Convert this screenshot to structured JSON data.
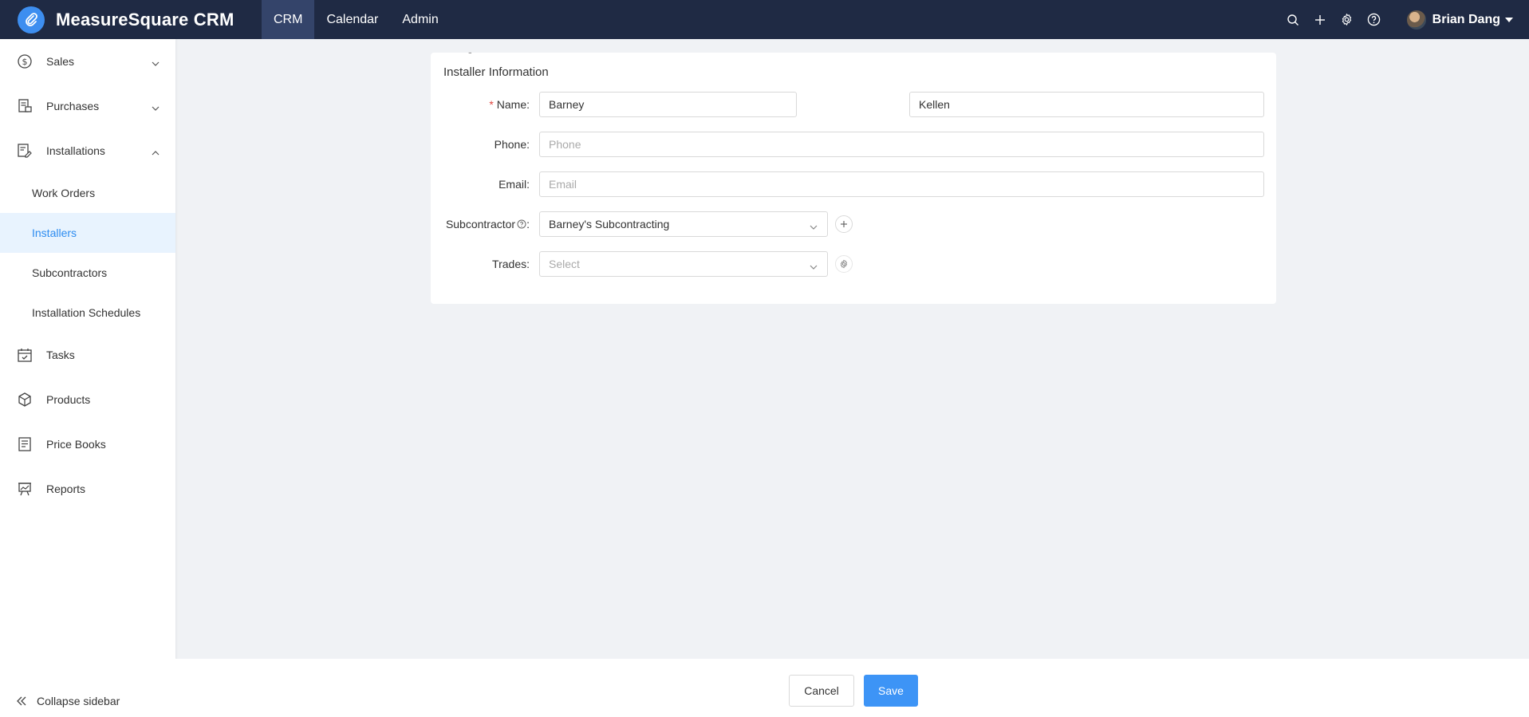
{
  "brand": {
    "title": "MeasureSquare CRM",
    "logo_icon": "paperclip-icon"
  },
  "topnav": [
    {
      "label": "CRM",
      "active": true
    },
    {
      "label": "Calendar",
      "active": false
    },
    {
      "label": "Admin",
      "active": false
    }
  ],
  "toolbar_icons": [
    "search-icon",
    "plus-icon",
    "gear-icon",
    "help-icon"
  ],
  "user": {
    "name": "Brian Dang"
  },
  "sidebar": {
    "sales": "Sales",
    "purchases": "Purchases",
    "installations": "Installations",
    "sub": {
      "work_orders": "Work Orders",
      "installers": "Installers",
      "subcontractors": "Subcontractors",
      "installation_schedules": "Installation Schedules"
    },
    "tasks": "Tasks",
    "products": "Products",
    "price_books": "Price Books",
    "reports": "Reports",
    "collapse": "Collapse sidebar"
  },
  "form": {
    "title": "Installer Information",
    "name_label": "Name:",
    "required_mark": "*",
    "first_name": "Barney",
    "name_separator": "-",
    "last_name": "Kellen",
    "phone_label": "Phone:",
    "phone_placeholder": "Phone",
    "email_label": "Email:",
    "email_placeholder": "Email",
    "subcontractor_label": "Subcontractor",
    "label_colon": ":",
    "subcontractor_value": "Barney's Subcontracting",
    "trades_label": "Trades:",
    "trades_placeholder": "Select"
  },
  "footer": {
    "cancel": "Cancel",
    "save": "Save"
  },
  "colors": {
    "topbar": "#1f2a44",
    "accent": "#3d94f6",
    "active_bg": "#e8f3fe"
  }
}
